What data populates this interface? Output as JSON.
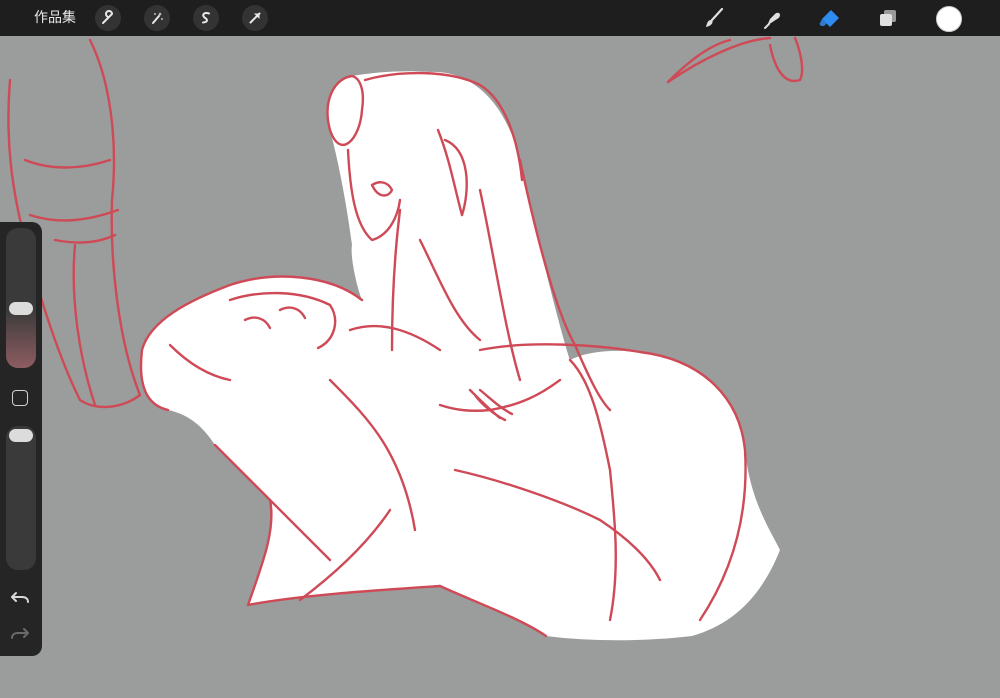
{
  "topbar": {
    "gallery_label": "作品集",
    "left_tools": [
      {
        "name": "adjustments",
        "icon": "wrench-icon"
      },
      {
        "name": "magic",
        "icon": "magic-wand-icon"
      },
      {
        "name": "selection",
        "icon": "selection-s-icon"
      },
      {
        "name": "transform",
        "icon": "arrow-cursor-icon"
      }
    ],
    "right_tools": [
      {
        "name": "brush",
        "icon": "brush-icon",
        "active": false
      },
      {
        "name": "smudge",
        "icon": "smudge-finger-icon",
        "active": false
      },
      {
        "name": "eraser",
        "icon": "eraser-icon",
        "active": true
      },
      {
        "name": "layers",
        "icon": "layers-icon",
        "active": false
      }
    ],
    "current_color": "#ffffff",
    "active_tool_color": "#2e8cf0"
  },
  "sidebar": {
    "brush_size_level": 0.42,
    "opacity_level": 0.98,
    "undo_icon": "undo-icon",
    "redo_icon": "redo-icon"
  },
  "canvas": {
    "background": "#9a9d9c",
    "sketch_color": "#cf4a57",
    "fill_color": "#ffffff"
  }
}
